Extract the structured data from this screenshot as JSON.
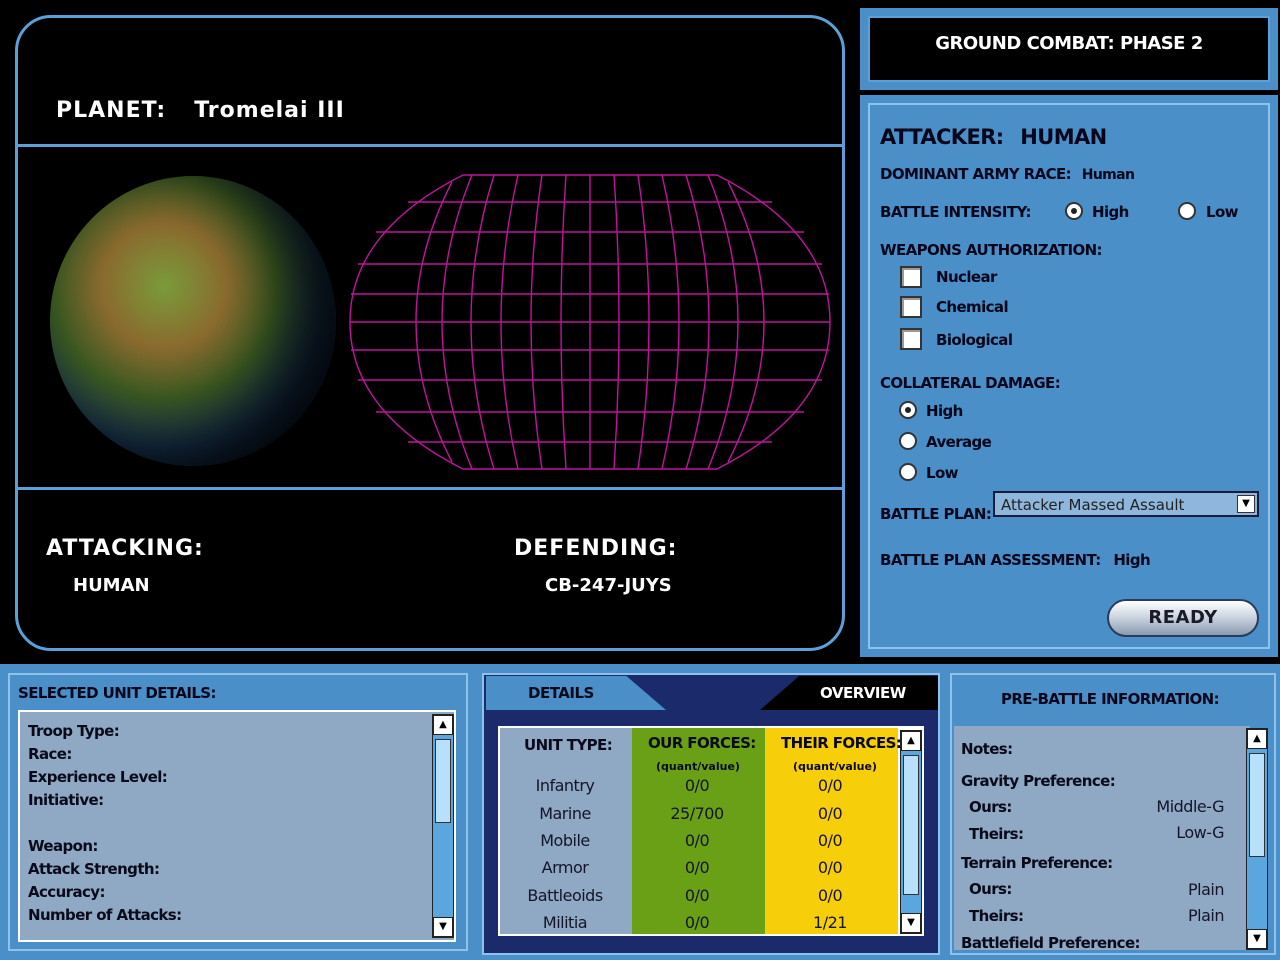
{
  "planet": {
    "label": "PLANET:",
    "name": "Tromelai III",
    "attacking_label": "ATTACKING:",
    "attacking_value": "HUMAN",
    "defending_label": "DEFENDING:",
    "defending_value": "CB-247-JUYS"
  },
  "header": {
    "title": "GROUND COMBAT: PHASE 2"
  },
  "options": {
    "attacker_label": "ATTACKER:",
    "attacker_value": "HUMAN",
    "dominant_label": "DOMINANT ARMY RACE:",
    "dominant_value": "Human",
    "intensity_label": "BATTLE INTENSITY:",
    "intensity_high": "High",
    "intensity_low": "Low",
    "intensity_selected": "High",
    "weapons_label": "WEAPONS AUTHORIZATION:",
    "weapons": [
      {
        "label": "Nuclear",
        "checked": false
      },
      {
        "label": "Chemical",
        "checked": false
      },
      {
        "label": "Biological",
        "checked": false
      }
    ],
    "collateral_label": "COLLATERAL DAMAGE:",
    "collateral": [
      {
        "label": "High",
        "selected": true
      },
      {
        "label": "Average",
        "selected": false
      },
      {
        "label": "Low",
        "selected": false
      }
    ],
    "plan_label": "BATTLE PLAN:",
    "plan_value": "Attacker Massed Assault",
    "assessment_label": "BATTLE PLAN ASSESSMENT:",
    "assessment_value": "High",
    "ready_label": "READY"
  },
  "unit_details": {
    "title": "SELECTED UNIT DETAILS:",
    "lines": [
      "Troop Type:",
      "Race:",
      "Experience Level:",
      "Initiative:",
      "",
      "Weapon:",
      "Attack Strength:",
      "Accuracy:",
      "Number of Attacks:"
    ]
  },
  "tabs": {
    "details": "DETAILS",
    "overview": "OVERVIEW",
    "active": "OVERVIEW"
  },
  "forces": {
    "col_type": "UNIT TYPE:",
    "col_ours": "OUR FORCES:",
    "col_theirs": "THEIR FORCES:",
    "sub_ours": "(quant/value)",
    "sub_theirs": "(quant/value)",
    "rows": [
      {
        "type": "Infantry",
        "ours": "0/0",
        "theirs": "0/0"
      },
      {
        "type": "Marine",
        "ours": "25/700",
        "theirs": "0/0"
      },
      {
        "type": "Mobile",
        "ours": "0/0",
        "theirs": "0/0"
      },
      {
        "type": "Armor",
        "ours": "0/0",
        "theirs": "0/0"
      },
      {
        "type": "Battleoids",
        "ours": "0/0",
        "theirs": "0/0"
      },
      {
        "type": "Militia",
        "ours": "0/0",
        "theirs": "1/21"
      }
    ]
  },
  "prebattle": {
    "title": "PRE-BATTLE INFORMATION:",
    "notes": "Notes:",
    "gravity_label": "Gravity Preference:",
    "gravity_ours_label": "Ours:",
    "gravity_ours": "Middle-G",
    "gravity_theirs_label": "Theirs:",
    "gravity_theirs": "Low-G",
    "terrain_label": "Terrain Preference:",
    "terrain_ours_label": "Ours:",
    "terrain_ours": "Plain",
    "terrain_theirs_label": "Theirs:",
    "terrain_theirs": "Plain",
    "battlefield_label": "Battlefield Preference:"
  },
  "colors": {
    "panel_blue": "#4a8fc7",
    "grid_magenta": "#c0149c",
    "our_forces_green": "#6aa016",
    "their_forces_yellow": "#f6cf0a"
  }
}
